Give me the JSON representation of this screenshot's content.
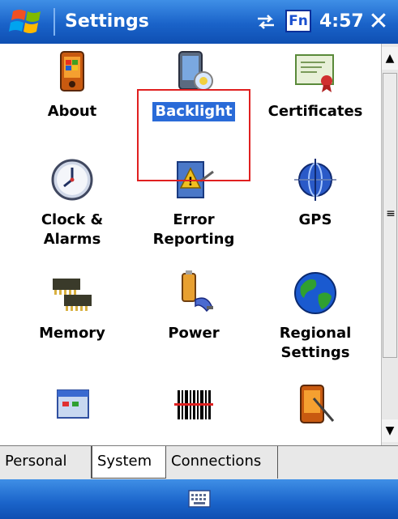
{
  "titlebar": {
    "title": "Settings",
    "fn_label": "Fn",
    "time": "4:57",
    "close_label": "✕"
  },
  "items": [
    {
      "label": "About",
      "icon": "pda-icon"
    },
    {
      "label": "Backlight",
      "icon": "backlight-icon",
      "selected": true
    },
    {
      "label": "Certificates",
      "icon": "certificate-icon"
    },
    {
      "label_line1": "Clock &",
      "label_line2": "Alarms",
      "icon": "clock-icon"
    },
    {
      "label_line1": "Error",
      "label_line2": "Reporting",
      "icon": "error-reporting-icon"
    },
    {
      "label": "GPS",
      "icon": "gps-icon"
    },
    {
      "label": "Memory",
      "icon": "memory-icon"
    },
    {
      "label": "Power",
      "icon": "power-icon"
    },
    {
      "label_line1": "Regional",
      "label_line2": "Settings",
      "icon": "globe-icon"
    }
  ],
  "tabs": [
    "Personal",
    "System",
    "Connections"
  ],
  "active_tab": "System",
  "colors": {
    "title_bar": "#1a63c9",
    "selection": "#2a6bd8",
    "highlight_box": "#e02020"
  }
}
